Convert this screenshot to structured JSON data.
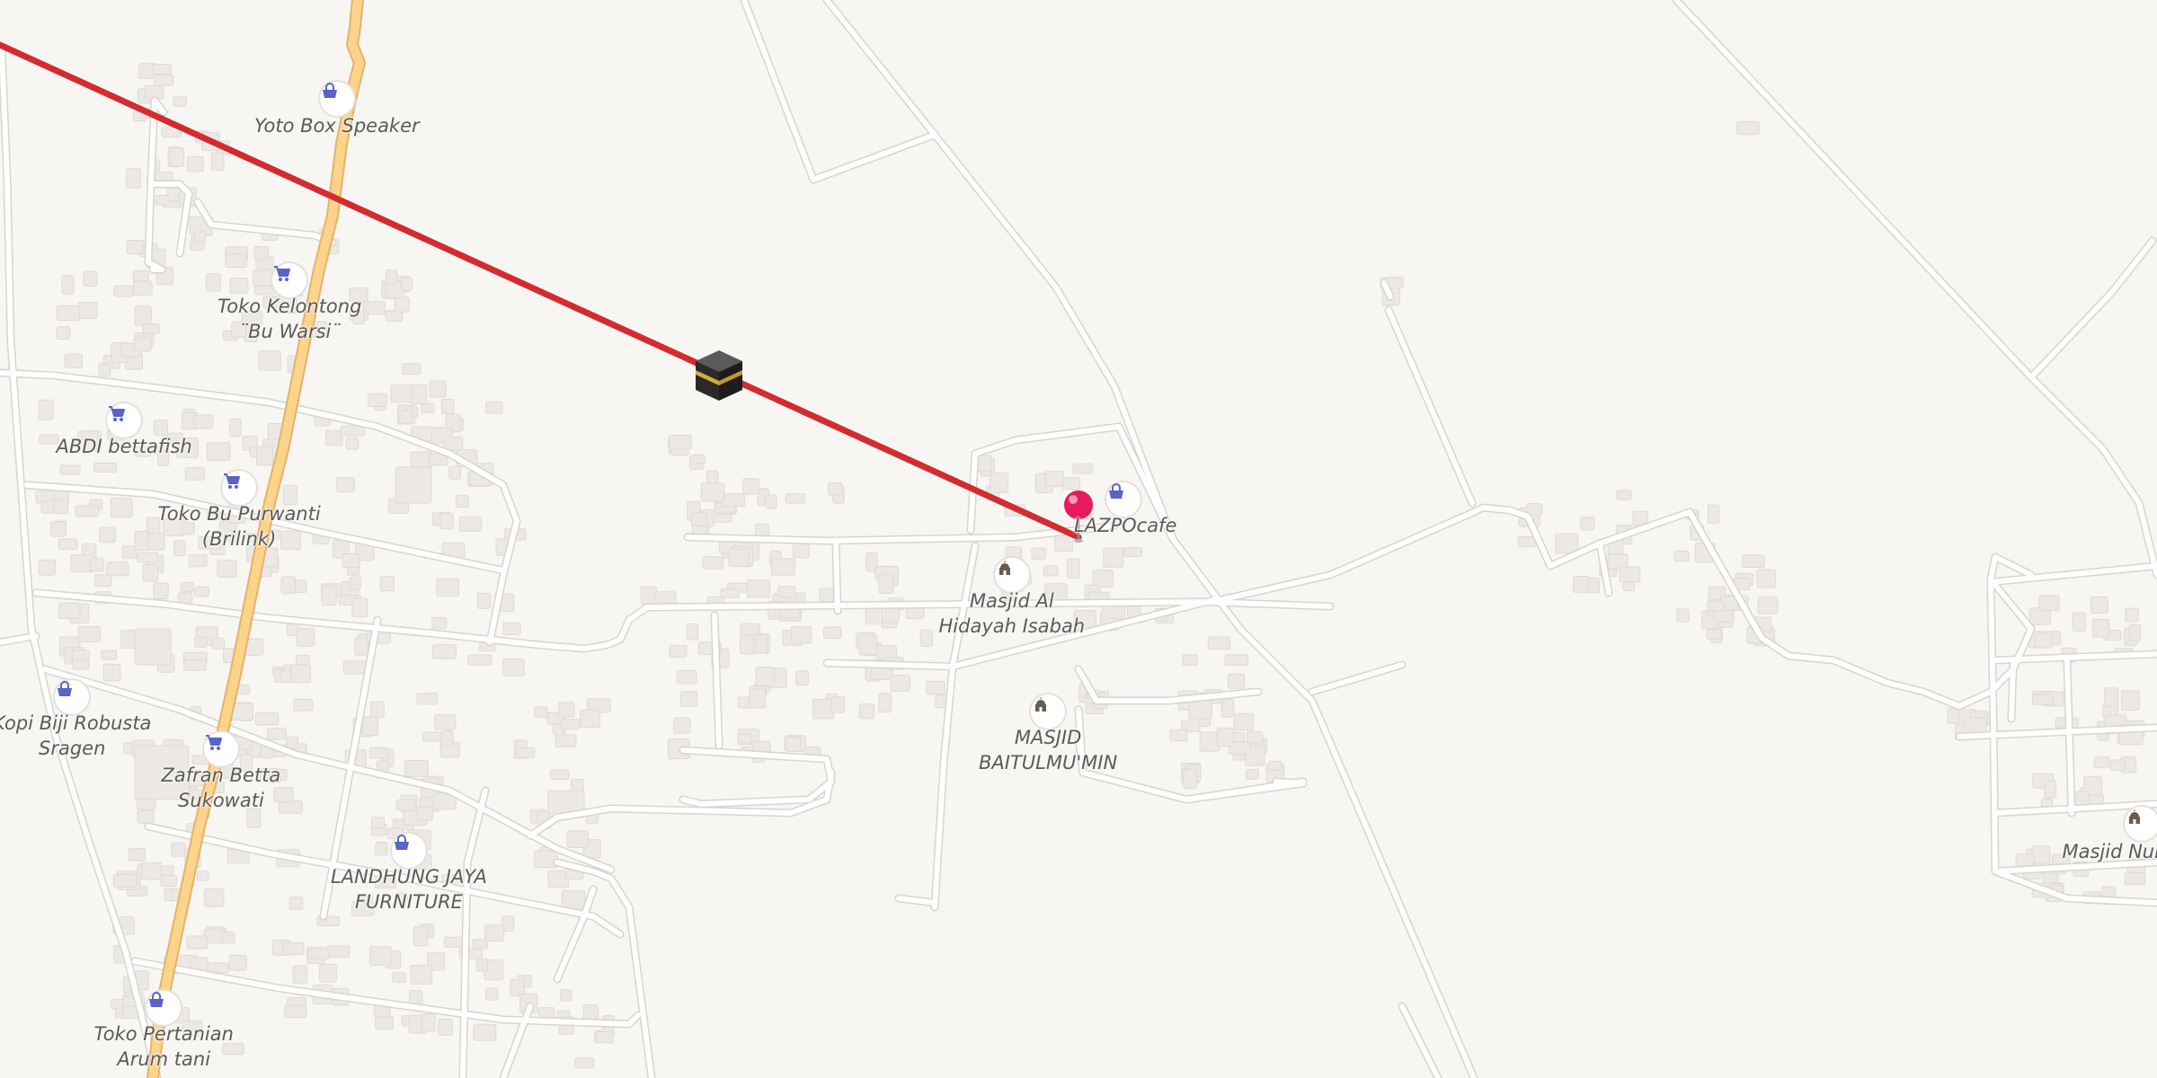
{
  "map": {
    "colors": {
      "background": "#f8f6f3",
      "road": "#ffffff",
      "road_casing": "#d8d5d0",
      "main_road": "#fbd38a",
      "main_road_casing": "#e3b46a",
      "building": "#ece9e5",
      "qibla_line": "#d32b2f",
      "pin": "#e8195e",
      "shop_icon": "#5a63c8",
      "mosque_icon": "#6b5a4e"
    },
    "qibla_marker_icon": "kaaba-icon",
    "location_pin_icon": "map-pin-icon",
    "pois": [
      {
        "id": "yoto",
        "icon": "shopping-bag-icon",
        "lines": [
          "Yoto Box Speaker"
        ]
      },
      {
        "id": "kelontong",
        "icon": "shopping-cart-icon",
        "lines": [
          "Toko Kelontong",
          "¨Bu Warsi¨"
        ]
      },
      {
        "id": "abdi",
        "icon": "shopping-cart-icon",
        "lines": [
          "ABDI bettafish"
        ]
      },
      {
        "id": "purwanti",
        "icon": "shopping-cart-icon",
        "lines": [
          "Toko Bu Purwanti",
          "(Brilink)"
        ]
      },
      {
        "id": "kopi",
        "icon": "shopping-bag-icon",
        "lines": [
          "Kopi Biji Robusta",
          "Sragen"
        ]
      },
      {
        "id": "zafran",
        "icon": "shopping-cart-icon",
        "lines": [
          "Zafran Betta",
          "Sukowati"
        ]
      },
      {
        "id": "landhung",
        "icon": "shopping-bag-icon",
        "lines": [
          "LANDHUNG JAYA",
          "FURNITURE"
        ]
      },
      {
        "id": "pertanian",
        "icon": "shopping-bag-icon",
        "lines": [
          "Toko Pertanian",
          "Arum tani"
        ]
      },
      {
        "id": "lazpo",
        "icon": "shopping-bag-icon",
        "lines": [
          "LAZPOcafe"
        ]
      },
      {
        "id": "alhidayah",
        "icon": "mosque-icon",
        "lines": [
          "Masjid Al",
          "Hidayah Isabah"
        ]
      },
      {
        "id": "baitulmumin",
        "icon": "mosque-icon",
        "lines": [
          "MASJID",
          "BAITULMU'MIN"
        ]
      },
      {
        "id": "nur",
        "icon": "mosque-icon",
        "lines": [
          "Masjid Nur"
        ]
      }
    ]
  }
}
